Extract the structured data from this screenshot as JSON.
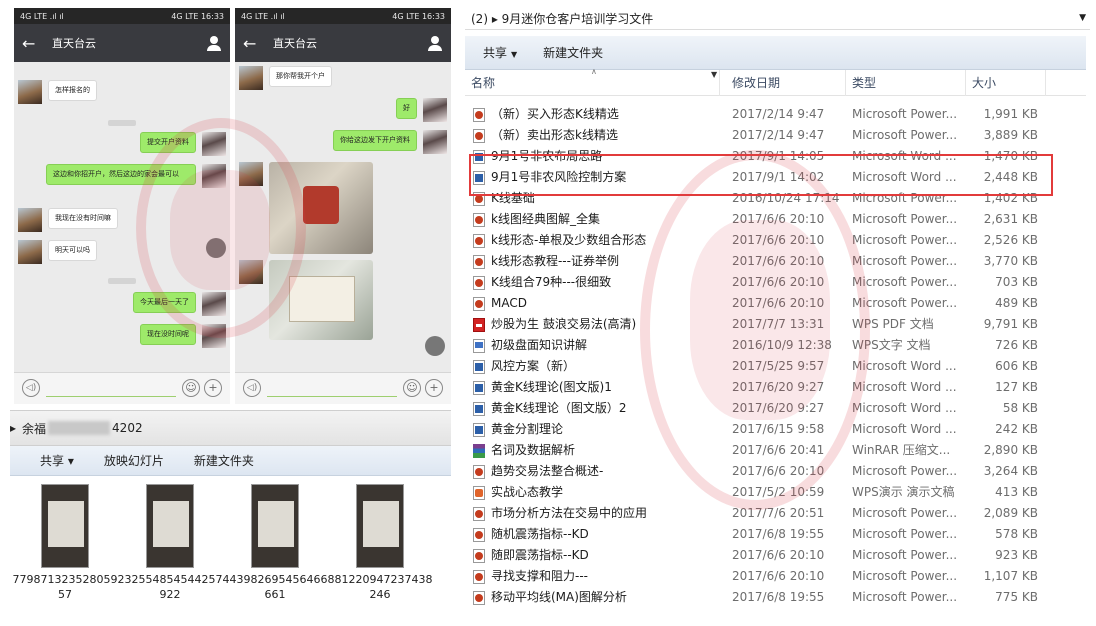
{
  "phone_left": {
    "status": {
      "left": "4G LTE .ıl ıl",
      "right": "4G LTE 16:33"
    },
    "title": "直天台云",
    "messages": [
      {
        "side": "left",
        "text": "怎样报名的"
      },
      {
        "side": "right",
        "text": "提交开户资料"
      },
      {
        "side": "right",
        "text": "这边和你招开户，然后这边的家会最可以"
      },
      {
        "side": "left",
        "text": "我现在没有时间嘛"
      },
      {
        "side": "left",
        "text": "明天可以吗"
      },
      {
        "side": "right",
        "text": "今天最后一天了"
      },
      {
        "side": "right",
        "text": "现在没时间呢"
      }
    ],
    "input": {
      "voice": "◁)",
      "emoji": "☺",
      "plus": "+"
    }
  },
  "phone_right": {
    "status": {
      "left": "4G LTE .ıl ıl",
      "right": "4G LTE 16:33"
    },
    "title": "直天台云",
    "messages": [
      {
        "side": "left",
        "text": "那你帮我开个户"
      },
      {
        "side": "right",
        "text": "好"
      },
      {
        "side": "right",
        "text": "你给这边发下开户资料"
      }
    ],
    "input": {
      "voice": "◁)",
      "emoji": "☺",
      "plus": "+"
    }
  },
  "explorer_small": {
    "breadcrumb_prefix": "余福",
    "breadcrumb_suffix": "4202",
    "toolbar": {
      "share": "共享 ▾",
      "slideshow": "放映幻灯片",
      "new_folder": "新建文件夹"
    },
    "files": [
      "77987132352805957",
      "232554854544257922",
      "443982695456466661",
      "881220947237438246"
    ],
    "files_display": [
      "7798713235280\n5957",
      "2325548545442\n57922",
      "4439826954564\n66661",
      "8812209472374\n38246"
    ]
  },
  "explorer_main": {
    "breadcrumb": "(2)  ▸  9月迷你仓客户培训学习文件",
    "toolbar": {
      "share": "共享",
      "new_folder": "新建文件夹"
    },
    "columns": {
      "name": "名称",
      "date": "修改日期",
      "type": "类型",
      "size": "大小"
    },
    "files": [
      {
        "name": "（新）买入形态K线精选",
        "date": "2017/2/14 9:47",
        "type": "Microsoft Power...",
        "size": "1,991 KB",
        "icon": "ppt"
      },
      {
        "name": "（新）卖出形态k线精选",
        "date": "2017/2/14 9:47",
        "type": "Microsoft Power...",
        "size": "3,889 KB",
        "icon": "ppt"
      },
      {
        "name": "9月1号非农布局思路",
        "date": "2017/9/1 14:05",
        "type": "Microsoft Word ...",
        "size": "1,470 KB",
        "icon": "doc"
      },
      {
        "name": "9月1号非农风险控制方案",
        "date": "2017/9/1 14:02",
        "type": "Microsoft Word ...",
        "size": "2,448 KB",
        "icon": "doc"
      },
      {
        "name": "K线基础",
        "date": "2016/10/24 17:14",
        "type": "Microsoft Power...",
        "size": "1,402 KB",
        "icon": "ppt"
      },
      {
        "name": "k线图经典图解_全集",
        "date": "2017/6/6 20:10",
        "type": "Microsoft Power...",
        "size": "2,631 KB",
        "icon": "ppt"
      },
      {
        "name": "k线形态-单根及少数组合形态",
        "date": "2017/6/6 20:10",
        "type": "Microsoft Power...",
        "size": "2,526 KB",
        "icon": "ppt"
      },
      {
        "name": "k线形态教程---证券举例",
        "date": "2017/6/6 20:10",
        "type": "Microsoft Power...",
        "size": "3,770 KB",
        "icon": "ppt"
      },
      {
        "name": "K线组合79种---很细致",
        "date": "2017/6/6 20:10",
        "type": "Microsoft Power...",
        "size": "703 KB",
        "icon": "ppt"
      },
      {
        "name": "MACD",
        "date": "2017/6/6 20:10",
        "type": "Microsoft Power...",
        "size": "489 KB",
        "icon": "ppt"
      },
      {
        "name": "炒股为生 鼓浪交易法(高清)",
        "date": "2017/7/7 13:31",
        "type": "WPS PDF 文档",
        "size": "9,791 KB",
        "icon": "pdf"
      },
      {
        "name": "初级盘面知识讲解",
        "date": "2016/10/9 12:38",
        "type": "WPS文字 文档",
        "size": "726 KB",
        "icon": "wpsdoc"
      },
      {
        "name": "风控方案（新）",
        "date": "2017/5/25 9:57",
        "type": "Microsoft Word ...",
        "size": "606 KB",
        "icon": "doc"
      },
      {
        "name": "黄金K线理论(图文版)1",
        "date": "2017/6/20 9:27",
        "type": "Microsoft Word ...",
        "size": "127 KB",
        "icon": "doc"
      },
      {
        "name": "黄金K线理论（图文版）2",
        "date": "2017/6/20 9:27",
        "type": "Microsoft Word ...",
        "size": "58 KB",
        "icon": "doc"
      },
      {
        "name": "黄金分割理论",
        "date": "2017/6/15 9:58",
        "type": "Microsoft Word ...",
        "size": "242 KB",
        "icon": "doc"
      },
      {
        "name": "名词及数据解析",
        "date": "2017/6/6 20:41",
        "type": "WinRAR 压缩文...",
        "size": "2,890 KB",
        "icon": "rar"
      },
      {
        "name": "趋势交易法整合概述-",
        "date": "2017/6/6 20:10",
        "type": "Microsoft Power...",
        "size": "3,264 KB",
        "icon": "ppt"
      },
      {
        "name": "实战心态教学",
        "date": "2017/5/2 10:59",
        "type": "WPS演示 演示文稿",
        "size": "413 KB",
        "icon": "wpsppt"
      },
      {
        "name": "市场分析方法在交易中的应用",
        "date": "2017/7/6 20:51",
        "type": "Microsoft Power...",
        "size": "2,089 KB",
        "icon": "ppt"
      },
      {
        "name": "随机震荡指标--KD",
        "date": "2017/6/8 19:55",
        "type": "Microsoft Power...",
        "size": "578 KB",
        "icon": "ppt"
      },
      {
        "name": "随即震荡指标--KD",
        "date": "2017/6/6 20:10",
        "type": "Microsoft Power...",
        "size": "923 KB",
        "icon": "ppt"
      },
      {
        "name": "寻找支撑和阻力---",
        "date": "2017/6/6 20:10",
        "type": "Microsoft Power...",
        "size": "1,107 KB",
        "icon": "ppt"
      },
      {
        "name": "移动平均线(MA)图解分析",
        "date": "2017/6/8 19:55",
        "type": "Microsoft Power...",
        "size": "775 KB",
        "icon": "ppt"
      }
    ]
  },
  "colors": {
    "highlight": "#e23b3b",
    "chat_green": "#9eea6a",
    "chat_header": "#393a3f",
    "watermark": "#d73c46"
  }
}
